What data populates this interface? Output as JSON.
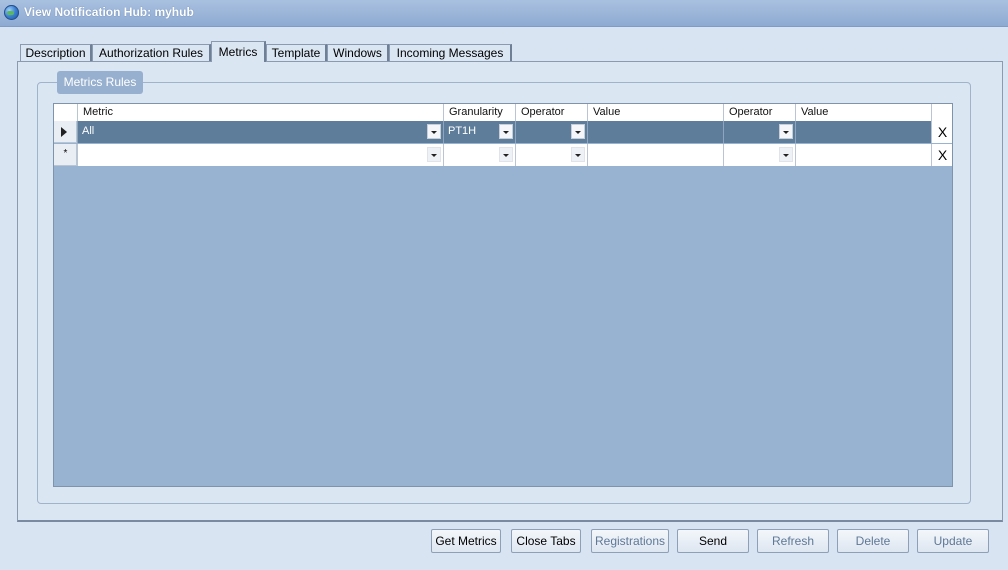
{
  "window": {
    "title": "View Notification Hub: myhub"
  },
  "tabs": [
    {
      "label": "Description"
    },
    {
      "label": "Authorization Rules"
    },
    {
      "label": "Metrics",
      "active": true
    },
    {
      "label": "Template"
    },
    {
      "label": "Windows"
    },
    {
      "label": "Incoming Messages"
    }
  ],
  "group": {
    "title": "Metrics Rules"
  },
  "grid": {
    "columns": [
      "Metric",
      "Granularity",
      "Operator",
      "Value",
      "Operator",
      "Value"
    ],
    "rows": [
      {
        "metric": "All",
        "granularity": "PT1H",
        "operator1": "",
        "value1": "",
        "operator2": "",
        "value2": "",
        "delete": "X"
      },
      {
        "metric": "",
        "granularity": "",
        "operator1": "",
        "value1": "",
        "operator2": "",
        "value2": "",
        "delete": "X",
        "new_row_marker": "*"
      }
    ]
  },
  "buttons": {
    "get_metrics": "Get Metrics",
    "close_tabs": "Close Tabs",
    "registrations": "Registrations",
    "send": "Send",
    "refresh": "Refresh",
    "delete": "Delete",
    "update": "Update"
  },
  "colors": {
    "selected_row": "#5d7d9a",
    "grid_background": "#98b3d2",
    "window_background": "#d8e4f2"
  }
}
